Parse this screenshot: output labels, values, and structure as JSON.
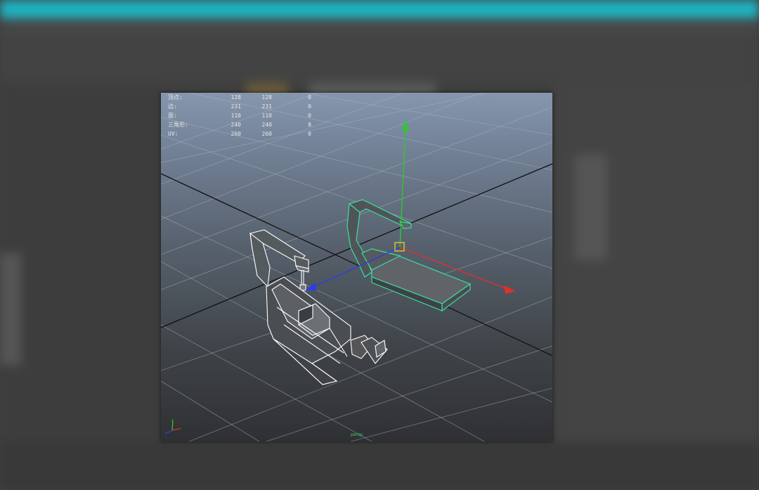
{
  "hud_stats": [
    {
      "label": "顶点:",
      "v1": "128",
      "v2": "128",
      "v3": "0"
    },
    {
      "label": "边:",
      "v1": "231",
      "v2": "231",
      "v3": "0"
    },
    {
      "label": "面:",
      "v1": "110",
      "v2": "110",
      "v3": "0"
    },
    {
      "label": "三角形:",
      "v1": "240",
      "v2": "240",
      "v3": "0"
    },
    {
      "label": "UV:",
      "v1": "260",
      "v2": "260",
      "v3": "0"
    }
  ],
  "viewport": {
    "camera_label": "persp",
    "colors": {
      "selection": "#38e0a0",
      "wireframe": "#ffffff",
      "axis_y": "#2ec82e",
      "axis_x": "#e0302e",
      "axis_z": "#2e3ee0",
      "pivot": "#e8d030"
    }
  },
  "icons": {
    "manipulator": "move-manipulator-icon",
    "view_axis": "view-axis-icon"
  }
}
